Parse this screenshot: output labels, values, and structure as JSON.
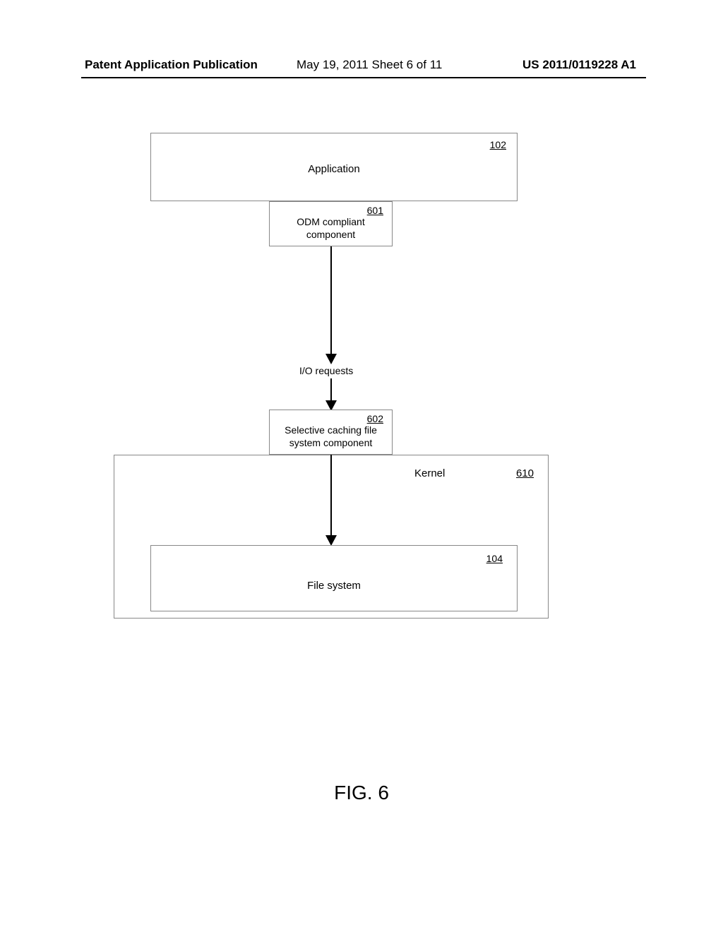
{
  "header": {
    "left": "Patent Application Publication",
    "mid": "May 19, 2011  Sheet 6 of 11",
    "right": "US 2011/0119228 A1"
  },
  "diagram": {
    "application": {
      "label": "Application",
      "ref": "102"
    },
    "odm": {
      "label": "ODM compliant\ncomponent",
      "ref": "601"
    },
    "io_label": "I/O requests",
    "selective_cache": {
      "label": "Selective caching file\nsystem component",
      "ref": "602"
    },
    "kernel": {
      "label": "Kernel",
      "ref": "610"
    },
    "filesystem": {
      "label": "File system",
      "ref": "104"
    }
  },
  "figure_label": "FIG. 6"
}
